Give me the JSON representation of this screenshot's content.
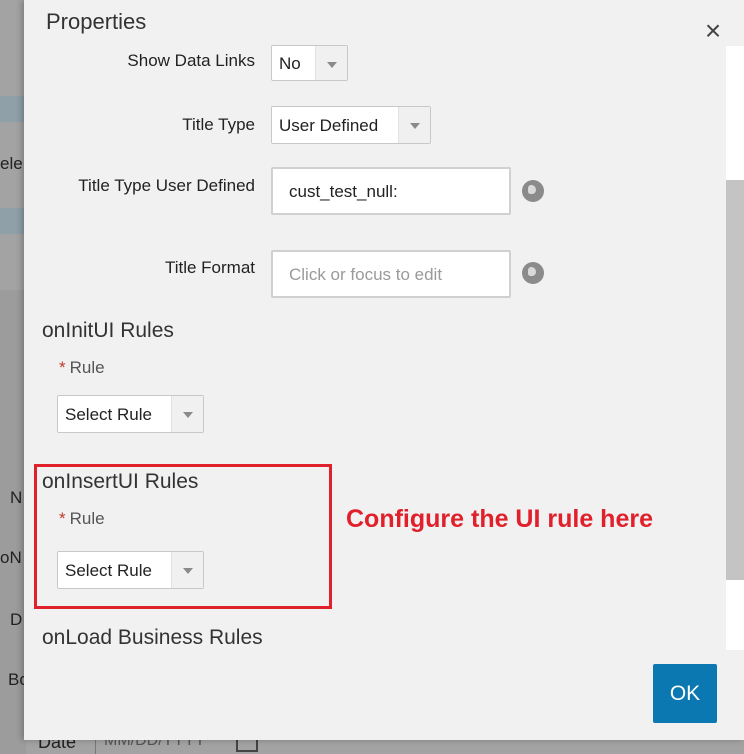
{
  "background": {
    "fragments": [
      "ele",
      "N",
      "oN",
      "D",
      "Bo"
    ],
    "date_label": "Date",
    "date_placeholder": "MM/DD/YYYY"
  },
  "dialog": {
    "title": "Properties",
    "close_label": "×",
    "ok_label": "OK"
  },
  "fields": {
    "show_data_links": {
      "label": "Show Data Links",
      "value": "No"
    },
    "title_type": {
      "label": "Title Type",
      "value": "User Defined"
    },
    "title_type_user_defined": {
      "label": "Title Type User Defined",
      "value": "cust_test_null:"
    },
    "title_format": {
      "label": "Title Format",
      "placeholder": "Click or focus to edit"
    }
  },
  "sections": {
    "on_init_ui": {
      "title": "onInitUI Rules",
      "rule_label": "Rule",
      "rule_value": "Select Rule"
    },
    "on_insert_ui": {
      "title": "onInsertUI Rules",
      "rule_label": "Rule",
      "rule_value": "Select Rule"
    },
    "on_load_business": {
      "title": "onLoad Business Rules"
    }
  },
  "annotation": {
    "text": "Configure the UI rule here",
    "color": "#e0202a"
  },
  "colors": {
    "primary": "#0c78b1",
    "dialog_bg": "#f1f1f1"
  },
  "icons": {
    "globe": "globe-icon",
    "dropdown": "chevron-down-icon",
    "close": "close-icon",
    "calendar": "calendar-icon"
  }
}
